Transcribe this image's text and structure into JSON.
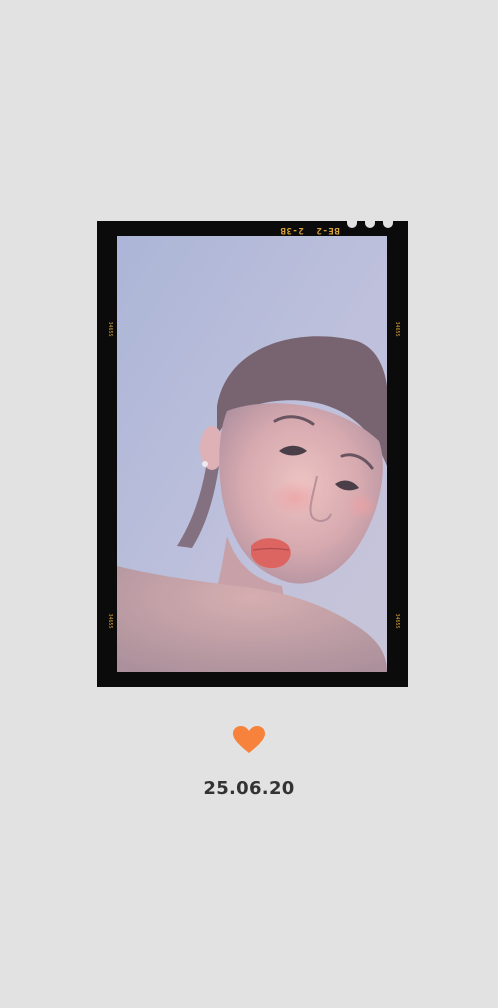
{
  "film": {
    "frame_code_left": "2-3B",
    "frame_code_right": "BE-2",
    "edge_marks": [
      "3465S",
      "3465S",
      "3465S",
      "3465S"
    ]
  },
  "photo": {
    "subject": "selfie-portrait"
  },
  "footer": {
    "heart_icon": "heart-icon",
    "heart_color": "#f7823b",
    "date": "25.06.20"
  },
  "colors": {
    "background": "#e2e2e2",
    "frame": "#0b0b0b",
    "film_text": "#d9a23a",
    "date_text": "#333333"
  }
}
